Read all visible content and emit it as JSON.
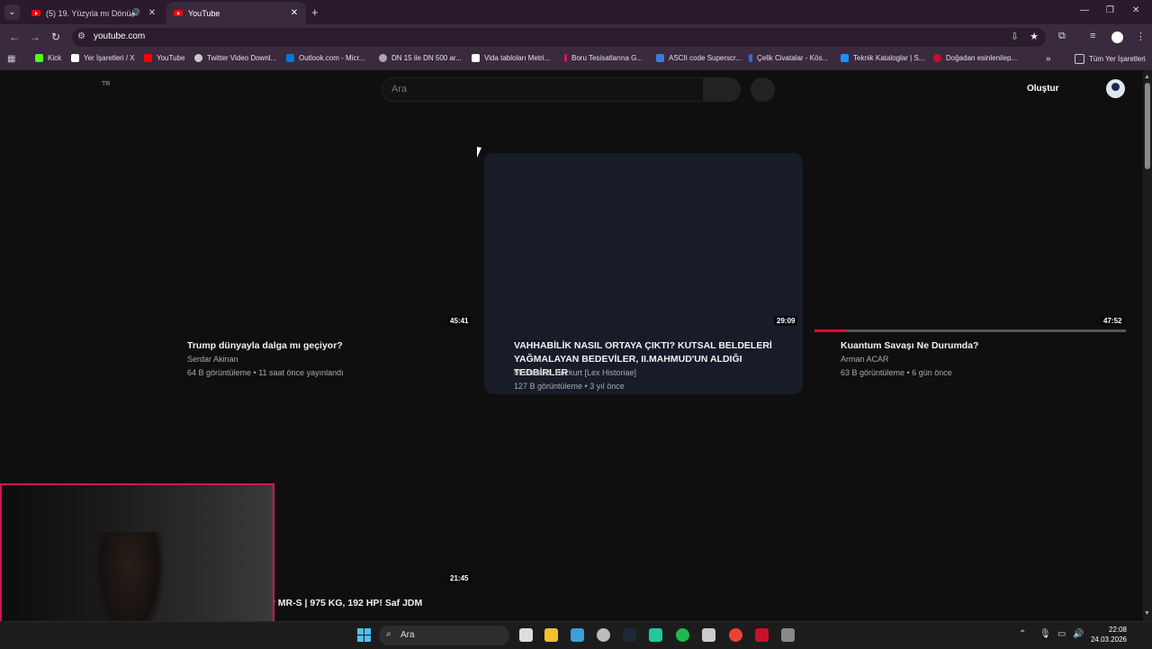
{
  "browser": {
    "tabs": [
      {
        "title": "(5) 19. Yüzyıla mı Dönüyoru...",
        "active": false,
        "audio": "🔊"
      },
      {
        "title": "YouTube",
        "active": true
      }
    ],
    "url": "youtube.com",
    "bookmarks": [
      {
        "label": "Kick",
        "color": "#53fc18"
      },
      {
        "label": "Yer İşaretleri / X",
        "color": "#ffffff"
      },
      {
        "label": "YouTube",
        "color": "#ff0000"
      },
      {
        "label": "Twitter Video Downl...",
        "color": "#cccccc"
      },
      {
        "label": "Outlook.com - Micr...",
        "color": "#0078d4"
      },
      {
        "label": "DN 15 ile DN 500 ar...",
        "color": "#aaaaaa"
      },
      {
        "label": "Vida tabloları Metri...",
        "color": "#ffffff"
      },
      {
        "label": "Boru Tesisatlarına G...",
        "color": "#d4145a"
      },
      {
        "label": "ASCII code Superscr...",
        "color": "#3b7ddd"
      },
      {
        "label": "Çelik Civatalar - Kös...",
        "color": "#2a6fdb"
      },
      {
        "label": "Teknik Kataloglar | S...",
        "color": "#1e90ff"
      },
      {
        "label": "Doğadan esinlenilер...",
        "color": "#c8102e"
      }
    ],
    "all_bookmarks": "Tüm Yer İşaretleri"
  },
  "youtube": {
    "region": "TR",
    "search_placeholder": "Ara",
    "create_label": "Oluştur",
    "videos": [
      {
        "duration": "45:41",
        "title": "Trump dünyayla dalga mı geçiyor?",
        "channel": "Serdar Akinan",
        "meta": "64 B görüntüleme • 11 saat önce yayınlandı"
      },
      {
        "duration": "29:09",
        "title": "VAHHABİLİK NASIL ORTAYA ÇIKTI? KUTSAL BELDELERİ YAĞMALAYAN BEDEVİLER, II.MAHMUD'UN ALDIĞI TEDBİRLER",
        "channel": "Mustafa B. Bozkurt [Lex Historiae]",
        "meta": "127 B görüntüleme • 3 yıl önce"
      },
      {
        "duration": "47:52",
        "title": "Kuantum Savaşı Ne Durumda?",
        "channel": "Arman ACAR",
        "meta": "63 B görüntüleme • 6 gün önce",
        "watched_fraction": 0.1
      },
      {
        "duration": "21:45",
        "title": "y MR-S | 975 KG, 192 HP! Saf JDM"
      }
    ]
  },
  "taskbar": {
    "search_label": "Ara",
    "time": "22:08",
    "date": "24.03.2026"
  }
}
